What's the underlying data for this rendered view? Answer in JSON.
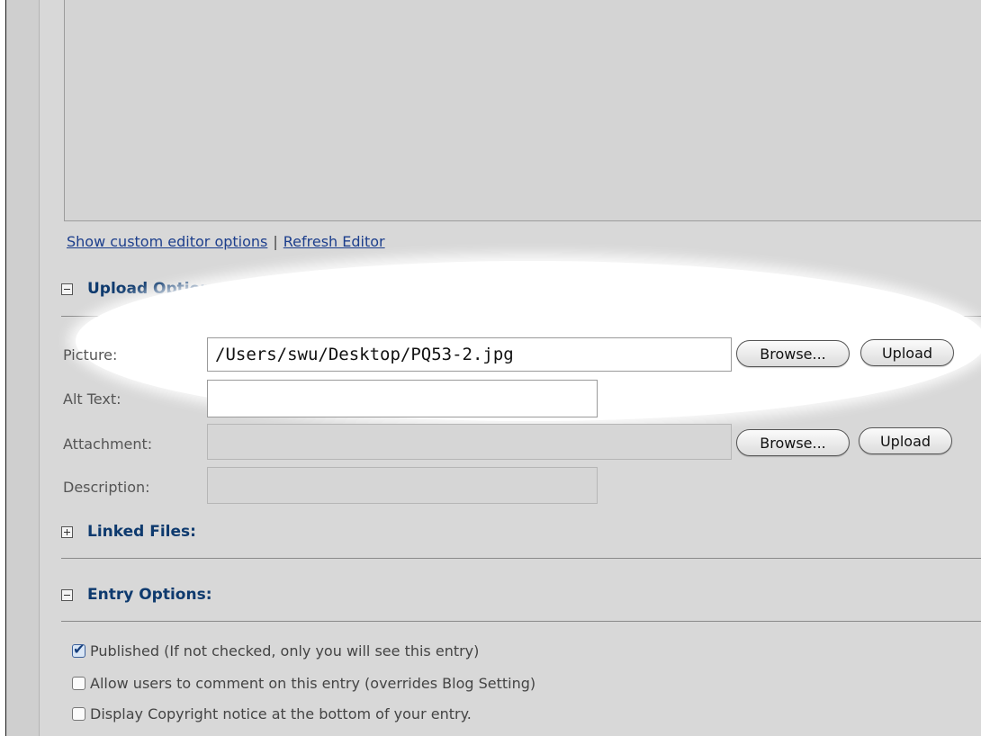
{
  "editor_links": {
    "custom_options": "Show custom editor options",
    "separator": "|",
    "refresh": "Refresh Editor"
  },
  "upload_options": {
    "title": "Upload Options:",
    "picture_label": "Picture:",
    "picture_value": "/Users/swu/Desktop/PQ53-2.jpg",
    "alt_text_label": "Alt Text:",
    "alt_text_value": "",
    "attachment_label": "Attachment:",
    "attachment_value": "",
    "description_label": "Description:",
    "description_value": "",
    "browse_label": "Browse...",
    "upload_label": "Upload"
  },
  "linked_files": {
    "title": "Linked Files:"
  },
  "entry_options": {
    "title": "Entry Options:",
    "checkboxes": [
      {
        "label": "Published (If not checked, only you will see this entry)",
        "checked": true
      },
      {
        "label": "Allow users to comment on this entry (overrides Blog Setting)",
        "checked": false
      },
      {
        "label": "Display Copyright notice at the bottom of your entry.",
        "checked": false
      }
    ]
  },
  "colors": {
    "heading": "#0e3a6e",
    "link": "#1c3e8c",
    "panel_bg": "#d8d8d8"
  }
}
